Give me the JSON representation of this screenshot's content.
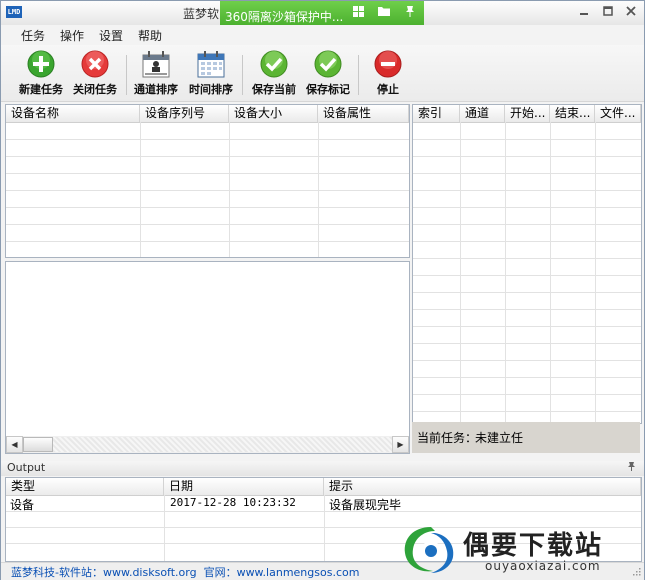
{
  "title": "蓝梦软",
  "app_icon_text": "LMD",
  "sandbox": {
    "text": "360隔离沙箱保护中...",
    "buttons": [
      "windows-icon",
      "folder-icon",
      "pin-icon"
    ]
  },
  "window_buttons": [
    "minimize-icon",
    "maximize-icon",
    "close-icon"
  ],
  "menu": [
    "任务",
    "操作",
    "设置",
    "帮助"
  ],
  "toolbar": {
    "new_task": "新建任务",
    "close_task": "关闭任务",
    "channel_sort": "通道排序",
    "time_sort": "时间排序",
    "save_current": "保存当前",
    "save_mark": "保存标记",
    "stop": "停止"
  },
  "device_columns": [
    "设备名称",
    "设备序列号",
    "设备大小",
    "设备属性"
  ],
  "task_columns": [
    "索引",
    "通道",
    "开始...",
    "结束...",
    "文件..."
  ],
  "current_task": {
    "label": "当前任务：",
    "value": "未建立任"
  },
  "output": {
    "title": "Output",
    "columns": [
      "类型",
      "日期",
      "提示"
    ],
    "rows": [
      {
        "type": "设备",
        "date": "2017-12-28 10:23:32",
        "message": "设备展现完毕"
      }
    ]
  },
  "footer": {
    "text": "蓝梦科技-软件站：www.disksoft.org  官网：www.lanmengsos.com"
  },
  "watermark": {
    "name": "偶要下载站",
    "url": "ouyaoxiazai.com"
  },
  "colors": {
    "add_green": "#3aa52f",
    "close_red": "#e53a3a",
    "check_green": "#5bb533",
    "stop_red": "#d92a2a",
    "sandbox_green": "#52b533",
    "link_blue": "#0a50b4"
  }
}
